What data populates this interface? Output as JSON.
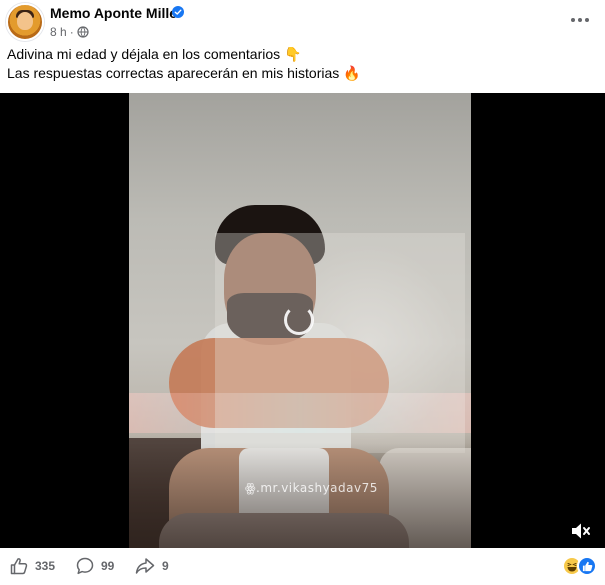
{
  "post": {
    "author": "Memo Aponte Mille",
    "time": "8 h",
    "separator": "·",
    "caption_line1": "Adivina mi edad y déjala en los comentarios 👇",
    "caption_line2": "Las respuestas correctas aparecerán en mis historias 🔥"
  },
  "video": {
    "watermark": "ꙮ.mr.vikashyadav75",
    "state": "loading"
  },
  "actions": {
    "likes": "335",
    "comments": "99",
    "shares": "9"
  },
  "icons": {
    "verified": "verified-badge-icon",
    "privacy": "globe-icon",
    "more": "more-horizontal-icon",
    "mute": "volume-muted-icon",
    "like": "thumbs-up-icon",
    "comment": "comment-bubble-icon",
    "share": "share-arrow-icon",
    "reactions": [
      "haha-reaction-icon",
      "like-reaction-icon"
    ]
  },
  "colors": {
    "brand_blue": "#1877f2",
    "secondary_text": "#65676b",
    "primary_text": "#050505",
    "media_background": "#000000"
  }
}
